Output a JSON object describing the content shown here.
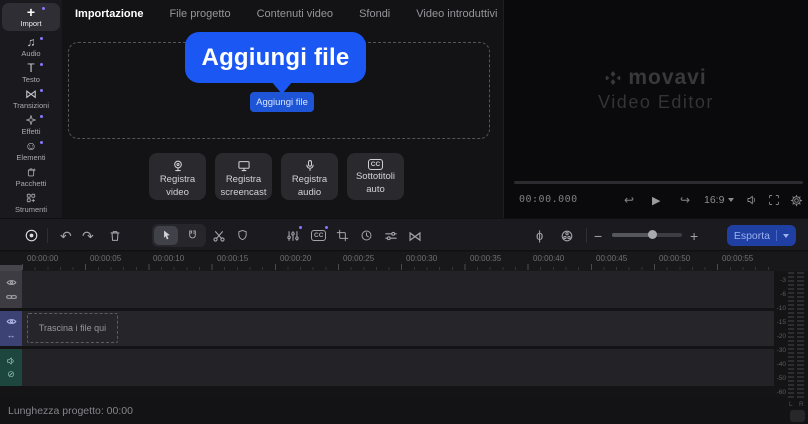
{
  "colors": {
    "accent_blue": "#1b57f2",
    "add_button_blue": "#1e55d6",
    "export_blue": "#1f3fa3",
    "notification_dot_purple": "#8678ff",
    "video_track_header": "#3c4273",
    "audio_track_header": "#1d473e"
  },
  "sidebar": {
    "items": [
      {
        "label": "Import",
        "glyph": "+",
        "active": true,
        "dot": true
      },
      {
        "label": "Audio",
        "glyph": "♫",
        "active": false,
        "dot": true
      },
      {
        "label": "Testo",
        "glyph": "T",
        "active": false,
        "dot": true
      },
      {
        "label": "Transizioni",
        "glyph": "⋈",
        "active": false,
        "dot": true
      },
      {
        "label": "Effetti",
        "active": false,
        "dot": true
      },
      {
        "label": "Elementi",
        "glyph": "☺",
        "active": false,
        "dot": true
      },
      {
        "label": "Pacchetti",
        "active": false,
        "dot": false
      },
      {
        "label": "Strumenti",
        "active": false,
        "dot": false
      }
    ]
  },
  "tabs": {
    "items": [
      {
        "label": "Importazione",
        "active": true
      },
      {
        "label": "File progetto",
        "active": false
      },
      {
        "label": "Contenuti video",
        "active": false
      },
      {
        "label": "Sfondi",
        "active": false
      },
      {
        "label": "Video introduttivi",
        "active": false
      }
    ]
  },
  "import_panel": {
    "tooltip_label": "Aggiungi file",
    "add_button_label": "Aggiungi file",
    "record_buttons": [
      {
        "line1": "Registra",
        "line2": "video"
      },
      {
        "line1": "Registra",
        "line2": "screencast"
      },
      {
        "line1": "Registra",
        "line2": "audio"
      },
      {
        "line1": "Sottotitoli",
        "line2": "auto"
      }
    ]
  },
  "preview": {
    "watermark_title": "movavi",
    "watermark_subtitle": "Video Editor",
    "timecode": "00:00.000",
    "aspect_ratio": "16:9",
    "glyphs": {
      "skip_back": "↩",
      "play": "▶",
      "skip_forward": "↪"
    }
  },
  "toolbar": {
    "export_label": "Esporta",
    "glyphs": {
      "undo": "↶",
      "redo": "↷",
      "transitions": "⋈",
      "audio_levels_phi": "ɸ",
      "minus": "−",
      "plus": "+",
      "cc": "CC"
    }
  },
  "timeline": {
    "ruler_labels": [
      "00:00:00",
      "00:00:05",
      "00:00:10",
      "00:00:15",
      "00:00:20",
      "00:00:25",
      "00:00:30",
      "00:00:35",
      "00:00:40",
      "00:00:45",
      "00:00:50",
      "00:00:55"
    ],
    "drop_hint": "Trascina i file qui",
    "track_glyphs": {
      "horizontal_arrows": "↔",
      "unlink": "⊘"
    },
    "audio_meter": {
      "db_labels": [
        "-3",
        "-6",
        "-10",
        "-15",
        "-20",
        "-30",
        "-40",
        "-50",
        "-60"
      ],
      "channels": {
        "left": "L",
        "right": "R"
      }
    }
  },
  "statusbar": {
    "project_length": "Lunghezza progetto: 00:00"
  }
}
